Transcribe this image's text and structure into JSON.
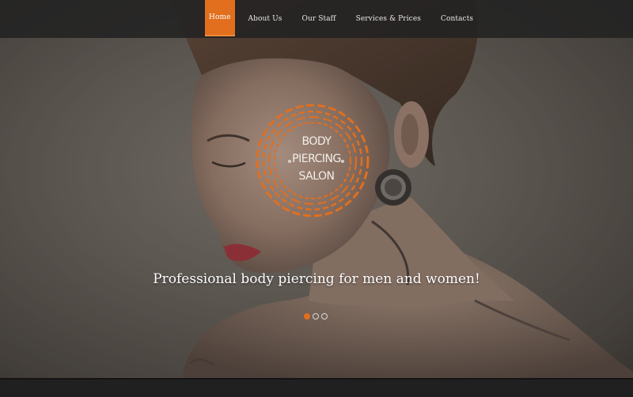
{
  "nav": {
    "items": [
      {
        "label": "Home",
        "active": true
      },
      {
        "label": "About Us",
        "active": false
      },
      {
        "label": "Our Staff",
        "active": false
      },
      {
        "label": "Services & Prices",
        "active": false
      },
      {
        "label": "Contacts",
        "active": false
      }
    ]
  },
  "hero": {
    "logo_lines": [
      "BODY",
      "PIERCING",
      "SALON"
    ],
    "tagline": "Professional body piercing for men and women!",
    "slider": {
      "total": 3,
      "active_index": 0
    }
  },
  "colors": {
    "accent": "#e16f1e",
    "topbar": "#222222",
    "text": "#ffffff"
  }
}
